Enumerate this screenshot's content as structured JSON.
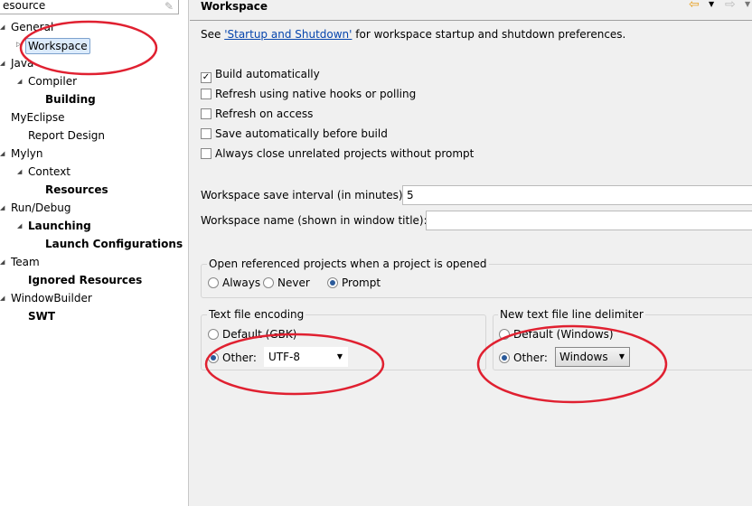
{
  "sidebar": {
    "filter_value": "esource",
    "items": [
      {
        "label": "General",
        "bold": false
      },
      {
        "label": "Workspace",
        "bold": false
      },
      {
        "label": "Java",
        "bold": false
      },
      {
        "label": "Compiler",
        "bold": false
      },
      {
        "label": "Building",
        "bold": true
      },
      {
        "label": "MyEclipse",
        "bold": false
      },
      {
        "label": "Report Design",
        "bold": false
      },
      {
        "label": "Mylyn",
        "bold": false
      },
      {
        "label": "Context",
        "bold": false
      },
      {
        "label": "Resources",
        "bold": true
      },
      {
        "label": "Run/Debug",
        "bold": false
      },
      {
        "label": "Launching",
        "bold": true
      },
      {
        "label": "Launch Configurations",
        "bold": true
      },
      {
        "label": "Team",
        "bold": false
      },
      {
        "label": "Ignored Resources",
        "bold": true
      },
      {
        "label": "WindowBuilder",
        "bold": false
      },
      {
        "label": "SWT",
        "bold": true
      }
    ]
  },
  "main": {
    "title": "Workspace",
    "intro_prefix": "See ",
    "intro_link": "'Startup and Shutdown'",
    "intro_suffix": " for workspace startup and shutdown preferences.",
    "checkboxes": [
      {
        "label": "Build automatically",
        "checked": true
      },
      {
        "label": "Refresh using native hooks or polling",
        "checked": false
      },
      {
        "label": "Refresh on access",
        "checked": false
      },
      {
        "label": "Save automatically before build",
        "checked": false
      },
      {
        "label": "Always close unrelated projects without prompt",
        "checked": false
      }
    ],
    "save_interval_label": "Workspace save interval (in minutes):",
    "save_interval_value": "5",
    "workspace_name_label": "Workspace name (shown in window title):",
    "workspace_name_value": "",
    "open_ref": {
      "label": "Open referenced projects when a project is opened",
      "options": [
        "Always",
        "Never",
        "Prompt"
      ],
      "selected": "Prompt"
    },
    "encoding": {
      "label": "Text file encoding",
      "default_label": "Default (GBK)",
      "other_label": "Other:",
      "selected": "Other",
      "value": "UTF-8"
    },
    "delimiter": {
      "label": "New text file line delimiter",
      "default_label": "Default (Windows)",
      "other_label": "Other:",
      "selected": "Other",
      "value": "Windows"
    }
  },
  "colors": {
    "annotation": "#e02030",
    "link": "#0645ad"
  }
}
